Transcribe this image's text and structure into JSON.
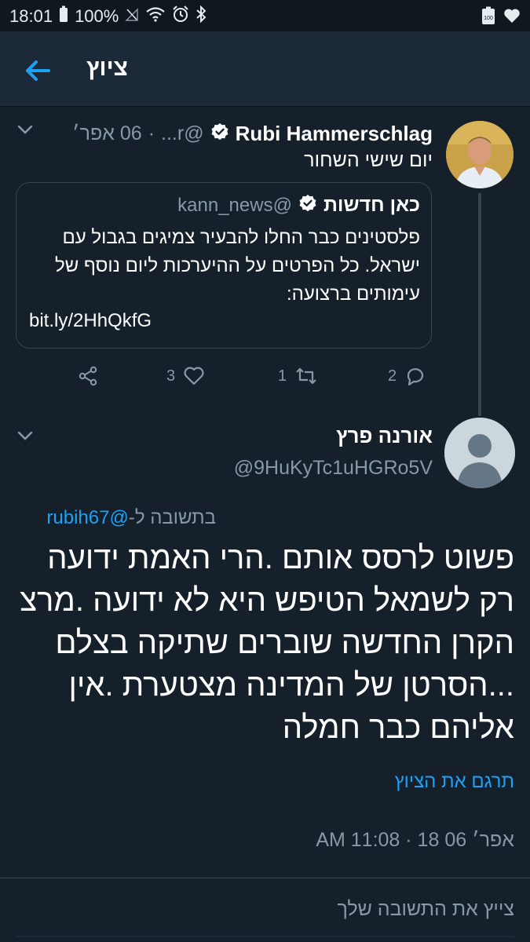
{
  "status_bar": {
    "time": "18:01",
    "battery": "100%",
    "battery_badge": "100"
  },
  "header": {
    "title": "ציוץ"
  },
  "tweet1": {
    "author_name": "Rubi Hammerschlag",
    "handle": "@r...",
    "date": "06 אפר׳",
    "separator": "·",
    "text": "יום שישי השחור",
    "quote": {
      "author_name": "כאן חדשות",
      "handle": "@kann_news",
      "text": "פלסטינים כבר החלו להבעיר צמיגים בגבול עם ישראל. כל הפרטים על ההיערכות ליום נוסף של עימותים ברצועה:",
      "link": "bit.ly/2HhQkfG"
    },
    "actions": {
      "replies": "2",
      "retweets": "1",
      "likes": "3"
    }
  },
  "tweet2": {
    "author_name": "אורנה פרץ",
    "handle": "@9HuKyTc1uHGRo5V",
    "reply_prefix": "בתשובה ל-",
    "reply_mention": "@rubih67",
    "body": "פשוט לרסס אותם .הרי האמת ידועה רק לשמאל הטיפש היא לא ידועה .מרצ הקרן החדשה שוברים שתיקה בצלם ...הסרטן של המדינה מצטערת .אין אליהם כבר חמלה",
    "translate_label": "תרגם את הציוץ",
    "timestamp": "אפר׳ 06 18 · 11:08 AM"
  },
  "reply_bar": {
    "placeholder": "צייץ את התשובה שלך"
  },
  "colors": {
    "background": "#15202b",
    "header": "#1c2938",
    "accent": "#1da1f2",
    "secondary_text": "#8899a6",
    "border": "#38444d"
  },
  "icons": [
    "back-arrow-icon",
    "verified-icon",
    "chevron-down-icon",
    "reply-icon",
    "retweet-icon",
    "like-icon",
    "share-icon",
    "default-avatar-icon"
  ]
}
